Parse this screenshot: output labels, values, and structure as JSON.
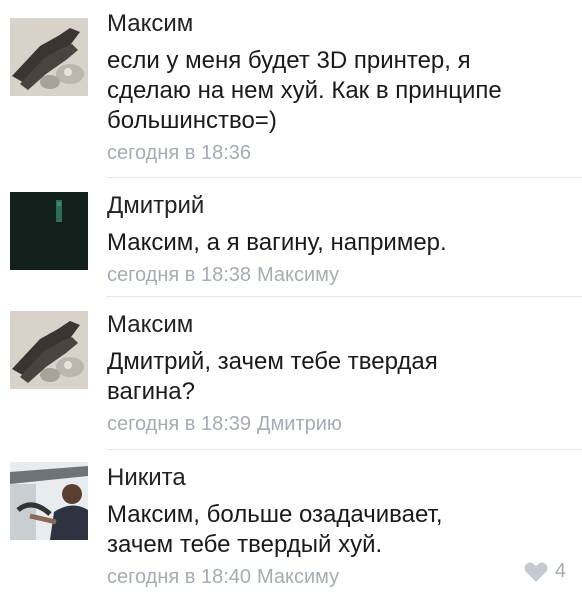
{
  "comments": [
    {
      "author": "Максим",
      "text_lines": [
        "если у меня будет 3D принтер, я",
        "сделаю на нем хуй. Как в принципе",
        "большинство=)"
      ],
      "time": "сегодня в 18:36",
      "reply_to": "",
      "avatar": "legs-photo-avatar"
    },
    {
      "author": "Дмитрий",
      "text_lines": [
        "Максим, а я вагину, например."
      ],
      "time": "сегодня в 18:38",
      "reply_to": "Максиму",
      "avatar": "dark-green-avatar"
    },
    {
      "author": "Максим",
      "text_lines": [
        "Дмитрий, зачем тебе твердая",
        "вагина?"
      ],
      "time": "сегодня в 18:39",
      "reply_to": "Дмитрию",
      "avatar": "legs-photo-avatar"
    },
    {
      "author": "Никита",
      "text_lines": [
        "Максим, больше озадачивает,",
        "зачем тебе твердый хуй."
      ],
      "time": "сегодня в 18:40",
      "reply_to": "Максиму",
      "avatar": "car-driver-avatar",
      "likes": "4"
    }
  ],
  "colors": {
    "meta": "#a6acb3",
    "divider": "#e3e6e9",
    "text": "#1a1a1a"
  },
  "icons": {
    "like": "heart-icon"
  }
}
